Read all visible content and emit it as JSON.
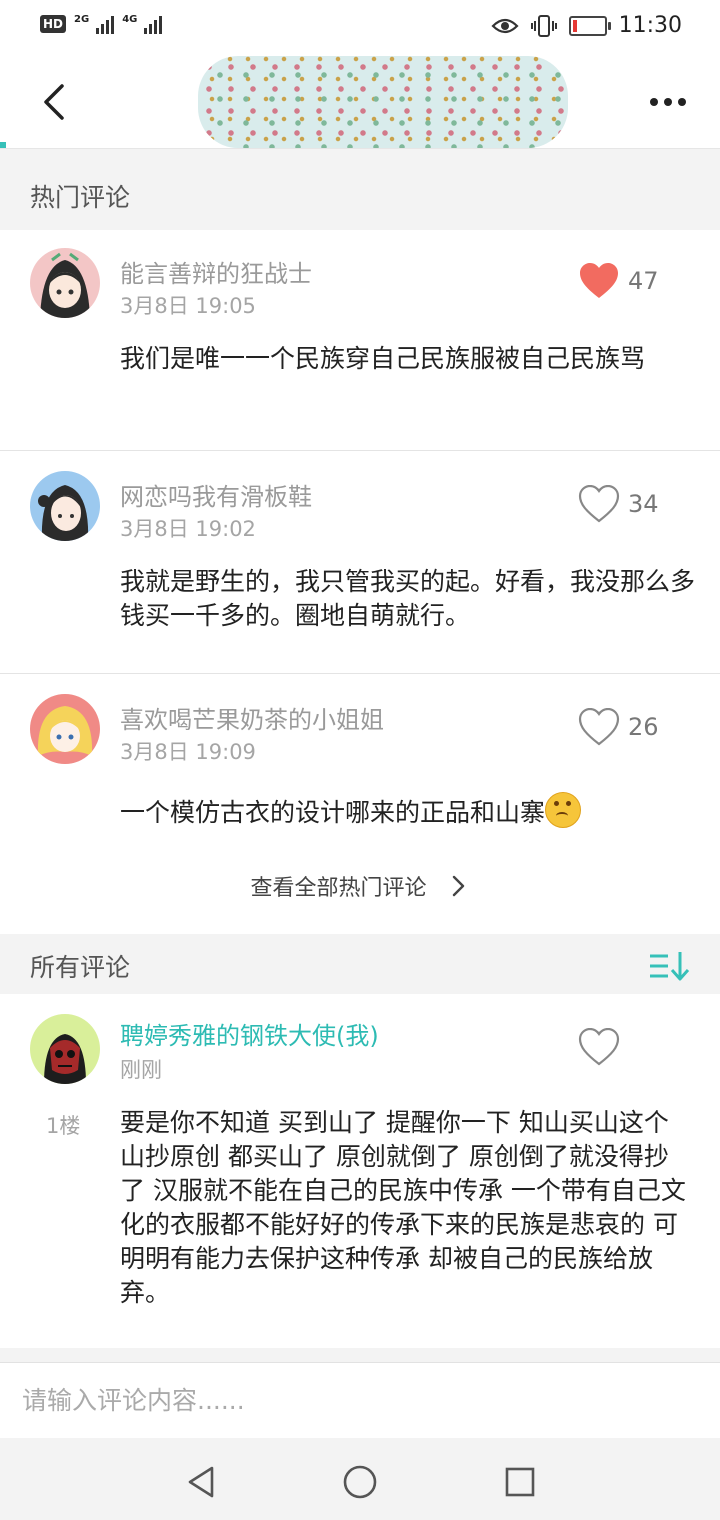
{
  "status_bar": {
    "hd": "HD",
    "sim1": "2G",
    "sim2": "4G",
    "time": "11:30",
    "battery_level": 0.12
  },
  "hot_section": {
    "title": "热门评论",
    "comments": [
      {
        "name": "能言善辩的狂战士",
        "time": "3月8日 19:05",
        "likes": "47",
        "liked": true,
        "text": "我们是唯一一个民族穿自己民族服被自己民族骂"
      },
      {
        "name": "网恋吗我有滑板鞋",
        "time": "3月8日 19:02",
        "likes": "34",
        "liked": false,
        "text": "我就是野生的，我只管我买的起。好看，我没那么多钱买一千多的。圈地自萌就行。"
      },
      {
        "name": "喜欢喝芒果奶茶的小姐姐",
        "time": "3月8日 19:09",
        "likes": "26",
        "liked": false,
        "text": "一个模仿古衣的设计哪来的正品和山寨"
      }
    ],
    "view_all": "查看全部热门评论"
  },
  "all_section": {
    "title": "所有评论",
    "comments": [
      {
        "name": "聘婷秀雅的钢铁大使(我)",
        "time": "刚刚",
        "floor": "1楼",
        "text": "要是你不知道 买到山了 提醒你一下 知山买山这个 山抄原创 都买山了 原创就倒了 原创倒了就没得抄了 汉服就不能在自己的民族中传承 一个带有自己文化的衣服都不能好好的传承下来的民族是悲哀的 可明明有能力去保护这种传承 却被自己的民族给放弃。"
      }
    ]
  },
  "input": {
    "placeholder": "请输入评论内容......"
  },
  "colors": {
    "accent": "#2dbbb3",
    "like_active": "#f26b60"
  }
}
